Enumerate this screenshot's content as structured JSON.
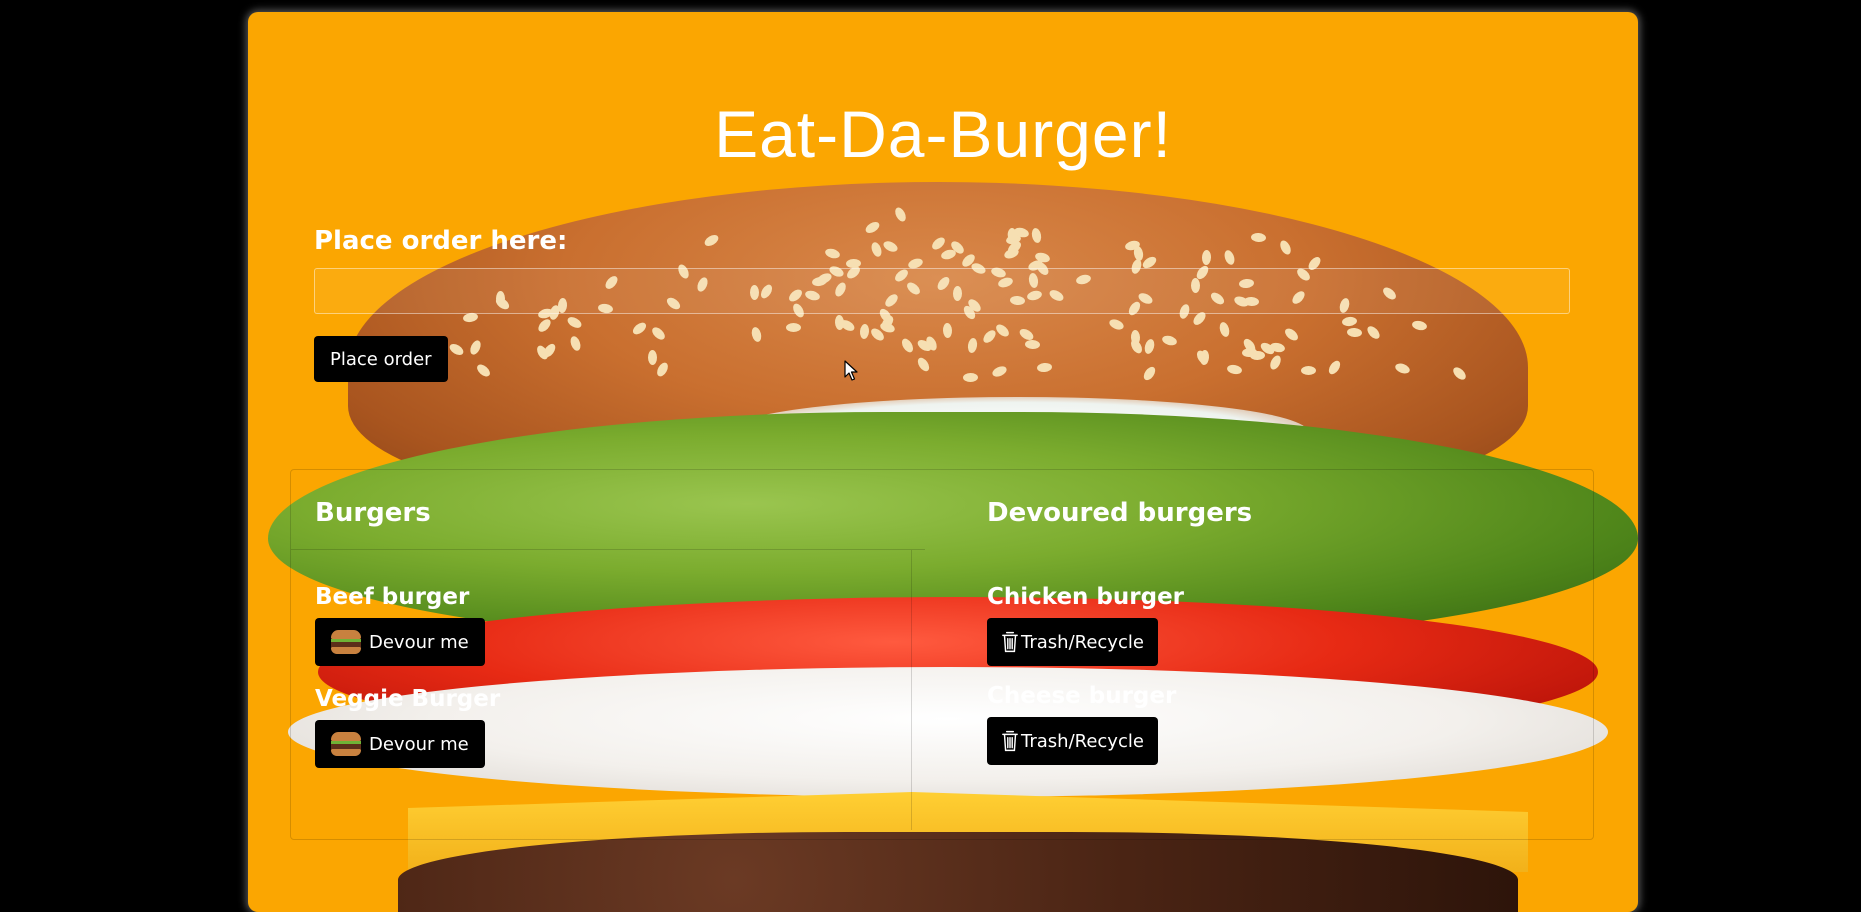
{
  "header": {
    "title": "Eat-Da-Burger!"
  },
  "order_form": {
    "label": "Place order here:",
    "input_value": "",
    "input_placeholder": "",
    "submit_label": "Place order"
  },
  "burgers": {
    "heading": "Burgers",
    "items": [
      {
        "name": "Beef burger",
        "action_label": "Devour me",
        "icon": "burger-icon"
      },
      {
        "name": "Veggie Burger",
        "action_label": "Devour me",
        "icon": "burger-icon"
      }
    ]
  },
  "devoured": {
    "heading": "Devoured burgers",
    "items": [
      {
        "name": "Chicken burger",
        "action_label": "Trash/Recycle",
        "icon": "trash-icon"
      },
      {
        "name": "Cheese burger",
        "action_label": "Trash/Recycle",
        "icon": "trash-icon"
      }
    ]
  },
  "colors": {
    "page_background": "#000000",
    "panel_background": "#fba601",
    "button_background": "#000000",
    "text": "#ffffff"
  }
}
